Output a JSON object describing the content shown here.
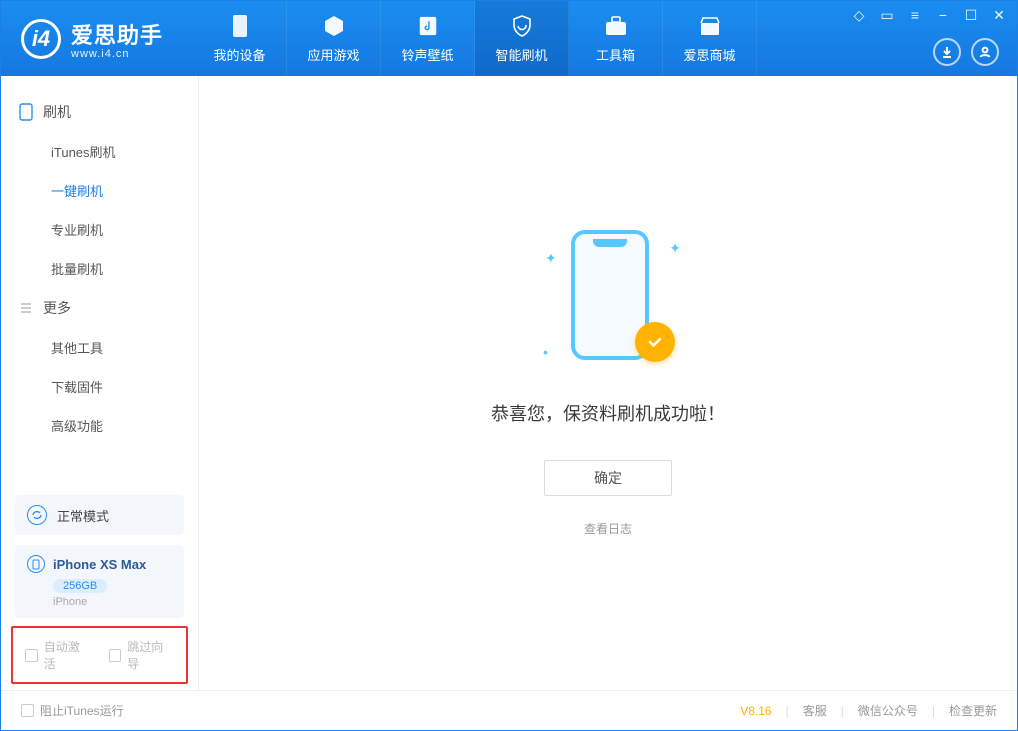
{
  "app": {
    "title": "爱思助手",
    "subtitle": "www.i4.cn"
  },
  "tabs": {
    "devices": "我的设备",
    "apps": "应用游戏",
    "media": "铃声壁纸",
    "flash": "智能刷机",
    "tools": "工具箱",
    "store": "爱思商城"
  },
  "sidebar": {
    "group_flash": "刷机",
    "items_flash": {
      "itunes": "iTunes刷机",
      "oneclick": "一键刷机",
      "pro": "专业刷机",
      "batch": "批量刷机"
    },
    "group_more": "更多",
    "items_more": {
      "other": "其他工具",
      "firmware": "下载固件",
      "advanced": "高级功能"
    }
  },
  "device_panel": {
    "mode": "正常模式",
    "name": "iPhone XS Max",
    "capacity": "256GB",
    "type": "iPhone"
  },
  "checks": {
    "auto_activate": "自动激活",
    "skip_guide": "跳过向导"
  },
  "main": {
    "message": "恭喜您，保资料刷机成功啦！",
    "ok": "确定",
    "log": "查看日志"
  },
  "footer": {
    "block_itunes": "阻止iTunes运行",
    "version": "V8.16",
    "support": "客服",
    "wechat": "微信公众号",
    "update": "检查更新"
  }
}
